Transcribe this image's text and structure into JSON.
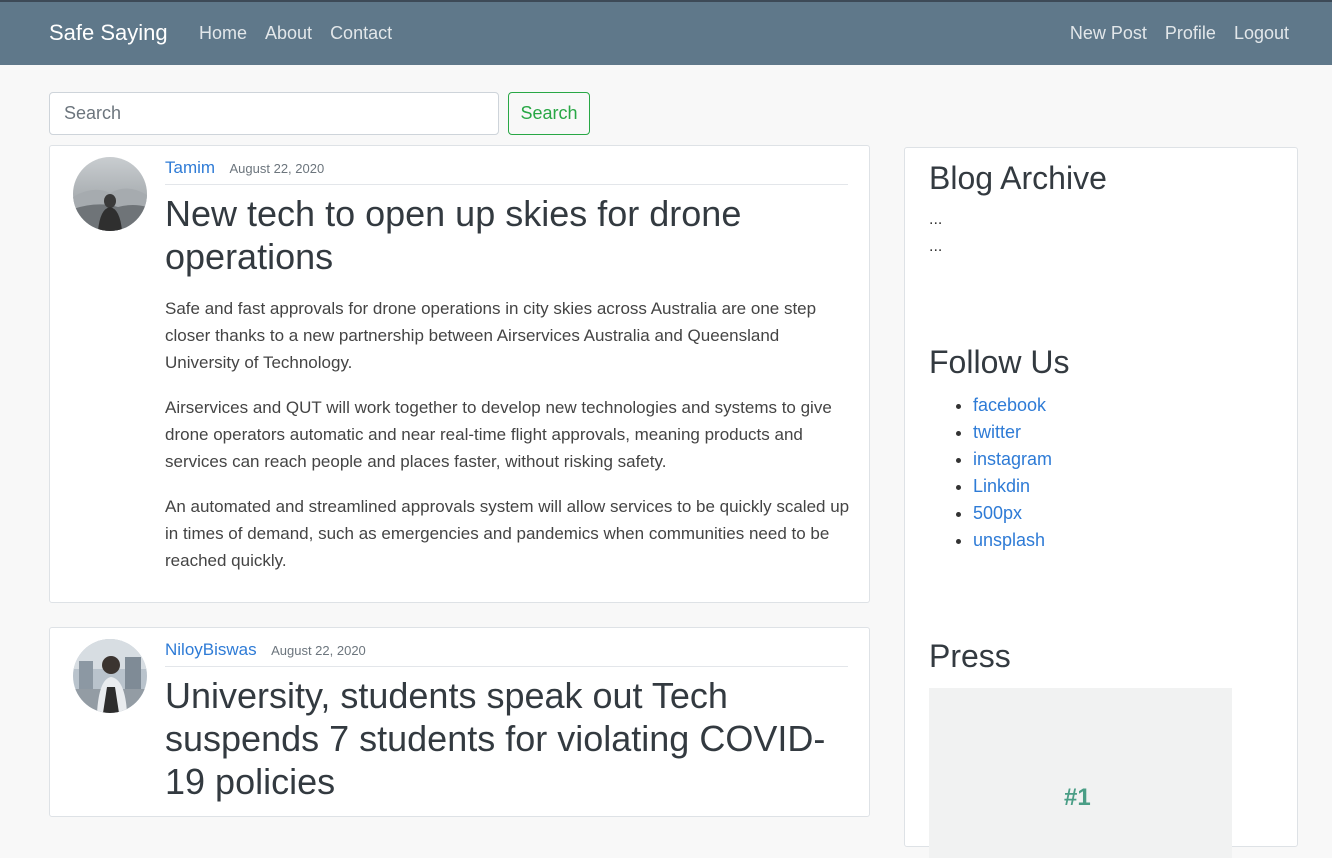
{
  "nav": {
    "brand": "Safe Saying",
    "left": [
      "Home",
      "About",
      "Contact"
    ],
    "right": [
      "New Post",
      "Profile",
      "Logout"
    ]
  },
  "search": {
    "placeholder": "Search",
    "button": "Search"
  },
  "posts": [
    {
      "author": "Tamim",
      "date": "August 22, 2020",
      "title": "New tech to open up skies for drone operations",
      "paragraphs": [
        "Safe and fast approvals for drone operations in city skies across Australia are one step closer thanks to a new partnership between Airservices Australia and Queensland University of Technology.",
        "Airservices and QUT will work together to develop new technologies and systems to give drone operators automatic and near real-time flight approvals, meaning products and services can reach people and places faster, without risking safety.",
        "An automated and streamlined approvals system will allow services to be quickly scaled up in times of demand, such as emergencies and pandemics when communities need to be reached quickly."
      ]
    },
    {
      "author": "NiloyBiswas",
      "date": "August 22, 2020",
      "title": "University, students speak out Tech suspends 7 students for violating COVID-19 policies"
    }
  ],
  "sidebar": {
    "archive_title": "Blog Archive",
    "archive_items": [
      "...",
      "..."
    ],
    "follow_title": "Follow Us",
    "follow_links": [
      "facebook",
      "twitter",
      "instagram",
      "Linkdin",
      "500px",
      "unsplash"
    ],
    "press_title": "Press",
    "press_badge": "#1"
  }
}
